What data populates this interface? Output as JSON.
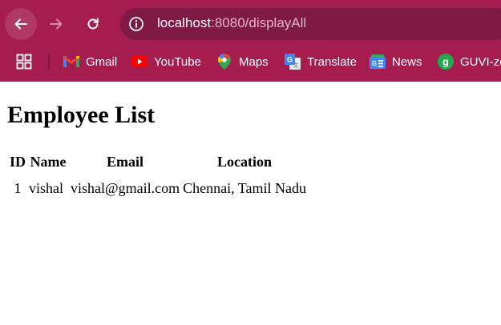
{
  "browser": {
    "url_host": "localhost",
    "url_path": ":8080/displayAll",
    "bookmarks": [
      {
        "label": "Gmail",
        "icon": "gmail-icon"
      },
      {
        "label": "YouTube",
        "icon": "youtube-icon"
      },
      {
        "label": "Maps",
        "icon": "maps-icon"
      },
      {
        "label": "Translate",
        "icon": "translate-icon"
      },
      {
        "label": "News",
        "icon": "news-icon"
      },
      {
        "label": "GUVI-ze",
        "icon": "guvi-icon"
      }
    ],
    "colors": {
      "chrome_bg": "#a51d4f",
      "omnibox_bg": "#7e1a44"
    }
  },
  "page": {
    "title": "Employee List",
    "table": {
      "headers": [
        "ID",
        "Name",
        "Email",
        "Location"
      ],
      "rows": [
        [
          "1",
          "vishal",
          "vishal@gmail.com",
          "Chennai, Tamil Nadu"
        ]
      ]
    }
  }
}
